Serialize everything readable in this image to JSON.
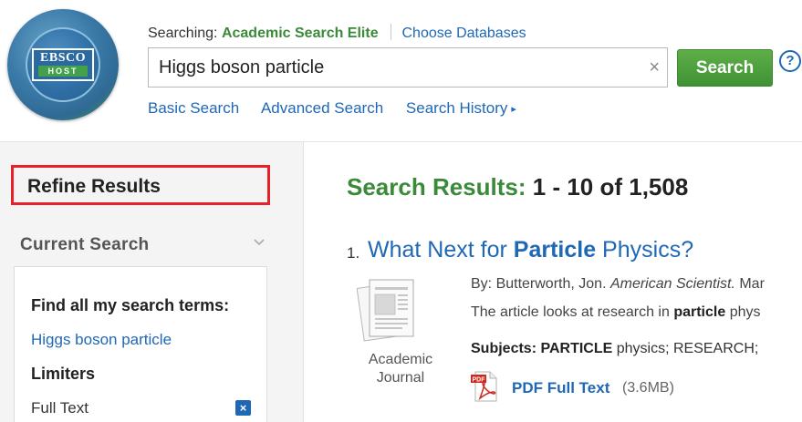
{
  "logo": {
    "line1": "EBSCO",
    "line2": "HOST"
  },
  "header": {
    "searching_label": "Searching:",
    "database": "Academic Search Elite",
    "choose_databases": "Choose Databases",
    "search_value": "Higgs boson particle",
    "clear_icon": "close-icon",
    "search_button": "Search",
    "help": "?"
  },
  "sublinks": {
    "basic": "Basic Search",
    "advanced": "Advanced Search",
    "history": "Search History",
    "history_arrow": "▸"
  },
  "left_panel": {
    "refine_title": "Refine Results",
    "current_search": "Current Search",
    "find_all": "Find all my search terms:",
    "term": "Higgs boson particle",
    "limiters": "Limiters",
    "full_text": "Full Text"
  },
  "results": {
    "label": "Search Results:",
    "range": "1 - 10 of 1,508",
    "items": [
      {
        "number": "1.",
        "title_before": "What Next for ",
        "title_bold": "Particle",
        "title_after": " Physics?",
        "by_label": "By: Butterworth, Jon. ",
        "source": "American Scientist.",
        "source_tail": " Mar",
        "abstract_before": "The article looks at research in ",
        "abstract_bold": "particle",
        "abstract_after": " phys",
        "subjects_label": "Subjects:",
        "subject_bold": "PARTICLE",
        "subjects_rest": " physics; RESEARCH;",
        "pub_type_1": "Academic",
        "pub_type_2": "Journal",
        "pdf_label": "PDF Full Text",
        "pdf_size": "(3.6MB)"
      }
    ]
  },
  "colors": {
    "link": "#1f68b5",
    "green": "#3a8a3a",
    "highlight_border": "#e8202a"
  }
}
